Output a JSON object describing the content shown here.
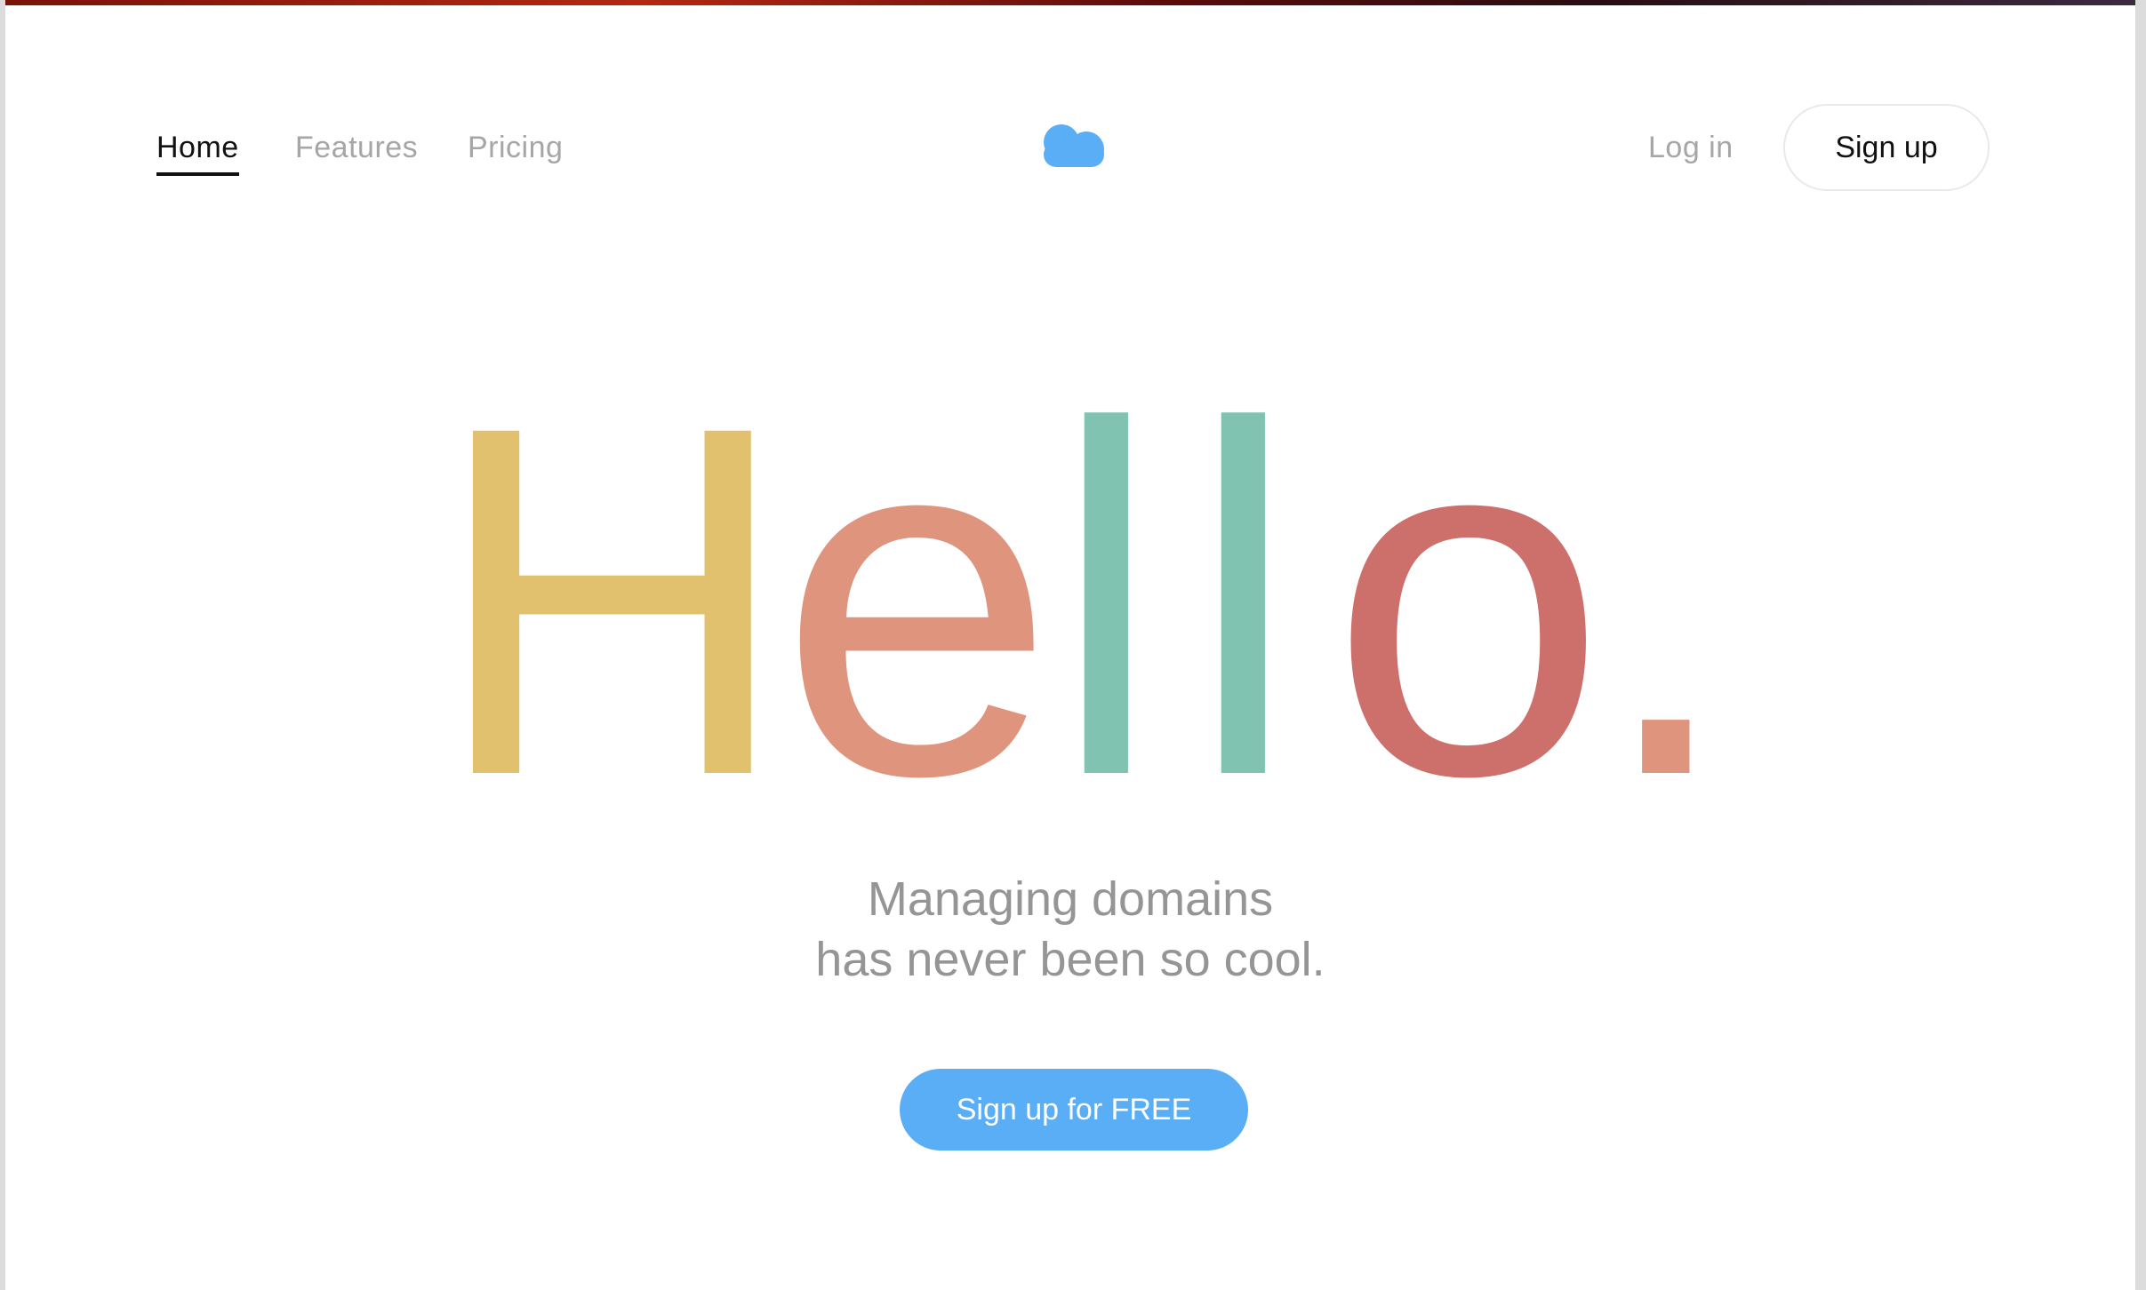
{
  "nav": {
    "home_label": "Home",
    "features_label": "Features",
    "pricing_label": "Pricing",
    "login_label": "Log in",
    "signup_label": "Sign up",
    "logo_icon": "cloud-icon"
  },
  "hero": {
    "letters": [
      {
        "char": "H",
        "color": "#e2c16e"
      },
      {
        "char": "e",
        "color": "#df947e"
      },
      {
        "char": "l",
        "color": "#80c3b0"
      },
      {
        "char": "l",
        "color": "#80c3b0"
      },
      {
        "char": "o",
        "color": "#cd706b"
      },
      {
        "char": ".",
        "color": "#df947e"
      }
    ],
    "tagline_line1": "Managing domains",
    "tagline_line2": "has never been so cool.",
    "cta_label": "Sign up for FREE"
  },
  "colors": {
    "accent": "#5aaef6",
    "text_muted": "#959595",
    "nav_inactive": "#a6a6a6",
    "nav_active": "#111111"
  }
}
